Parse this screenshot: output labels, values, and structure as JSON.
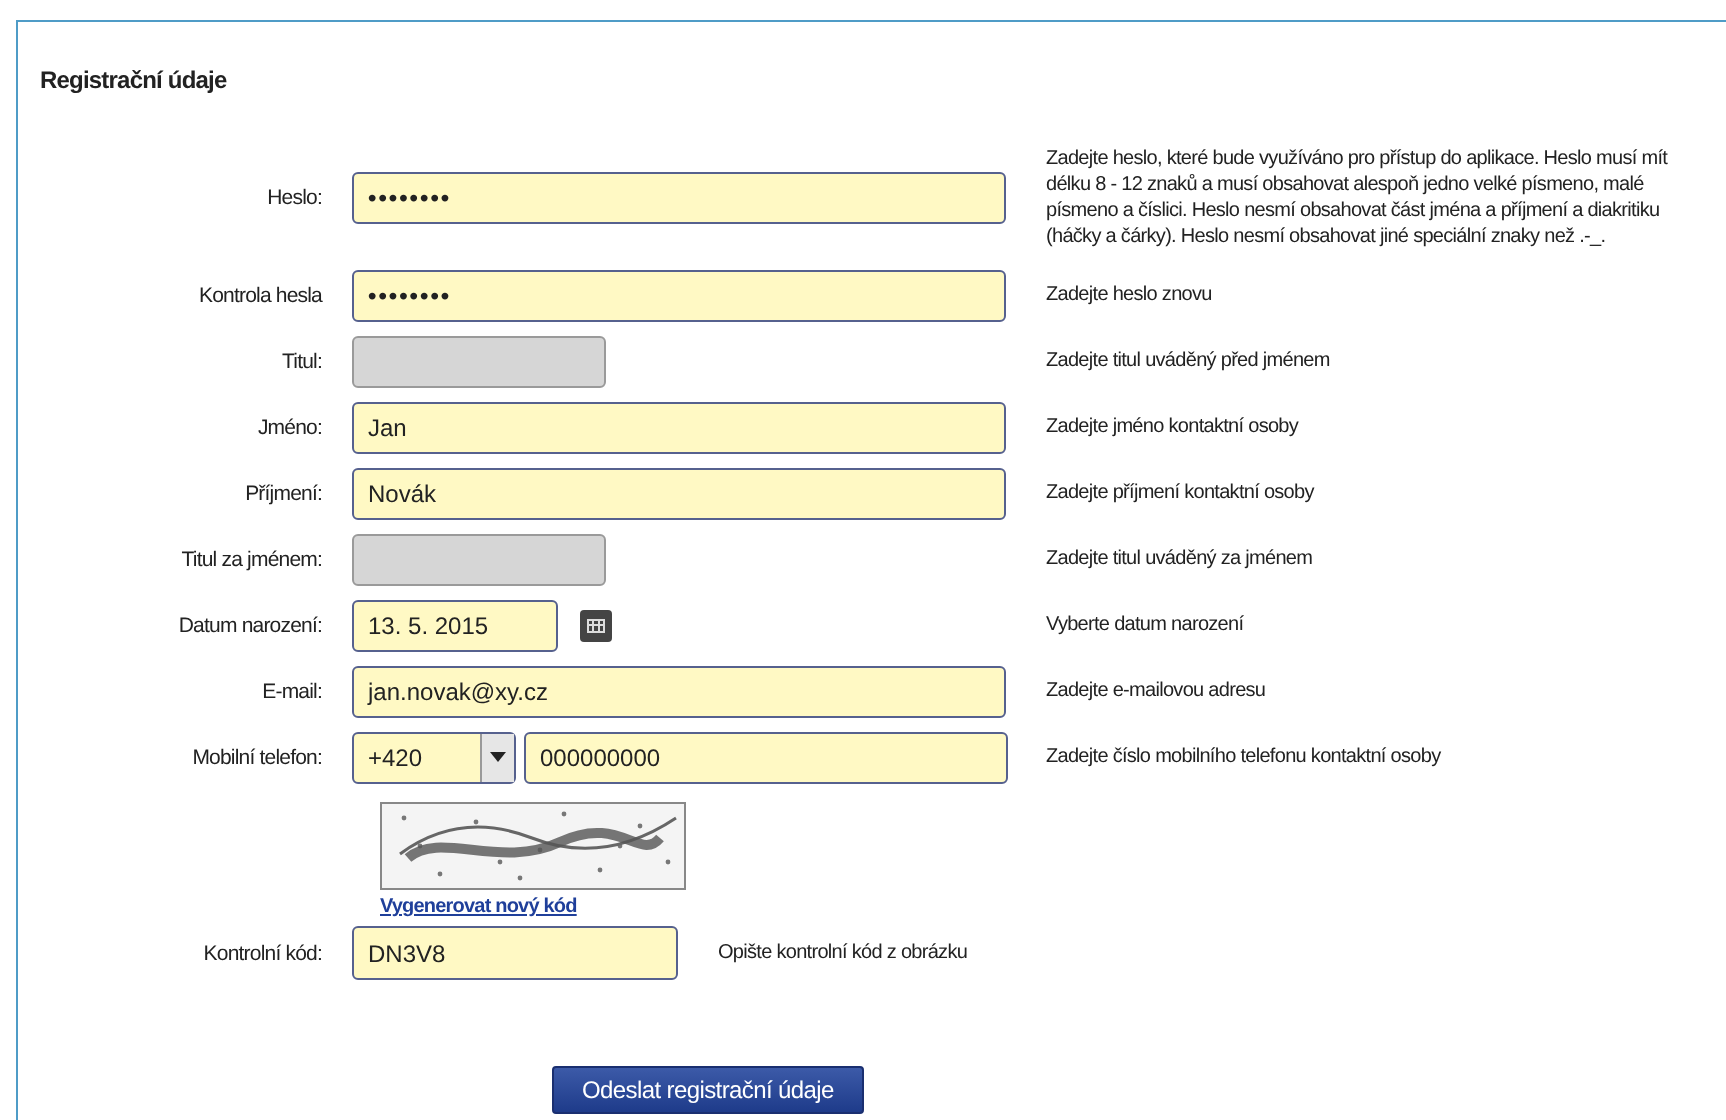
{
  "section": {
    "title": "Registrační údaje"
  },
  "fields": [
    {
      "kind": "password",
      "label": "Heslo:",
      "value": "••••••••",
      "disabled": false,
      "help": "Zadejte heslo, které bude využíváno pro přístup do aplikace. Heslo musí mít délku 8 - 12 znaků a musí obsahovat alespoň jedno velké písmeno, malé písmeno a číslici. Heslo nesmí obsahovat část jména a příjmení a diakritiku (háčky a čárky). Heslo nesmí obsahovat jiné speciální znaky než .-_."
    },
    {
      "kind": "password",
      "label": "Kontrola hesla",
      "value": "••••••••",
      "disabled": false,
      "help": "Zadejte heslo znovu"
    },
    {
      "kind": "short",
      "label": "Titul:",
      "disabled": true,
      "help": "Zadejte titul uváděný před jménem"
    },
    {
      "kind": "text",
      "label": "Jméno:",
      "value": "Jan",
      "disabled": false,
      "help": "Zadejte jméno kontaktní osoby"
    },
    {
      "kind": "text",
      "label": "Příjmení:",
      "value": "Novák",
      "disabled": false,
      "help": "Zadejte příjmení kontaktní osoby"
    },
    {
      "kind": "short",
      "label": "Titul za jménem:",
      "disabled": true,
      "help": "Zadejte titul uváděný za jménem"
    },
    {
      "kind": "date",
      "label": "Datum narození:",
      "value": "13. 5. 2015",
      "disabled": false,
      "help": "Vyberte datum narození"
    },
    {
      "kind": "text",
      "label": "E-mail:",
      "value": "jan.novak@xy.cz",
      "disabled": false,
      "help": "Zadejte e-mailovou adresu"
    },
    {
      "kind": "phone",
      "label": "Mobilní telefon:",
      "prefix": "+420",
      "value": "000000000",
      "disabled": false,
      "help": "Zadejte číslo mobilního telefonu kontaktní osoby"
    }
  ],
  "captcha": {
    "kind": "picture",
    "link": "Vygenerovat nový kód",
    "label": "Kontrolní kód:",
    "value": "DN3V8",
    "help": "Opište kontrolní kód z obrázku"
  },
  "submit": {
    "label": "Odeslat registrační údaje"
  }
}
